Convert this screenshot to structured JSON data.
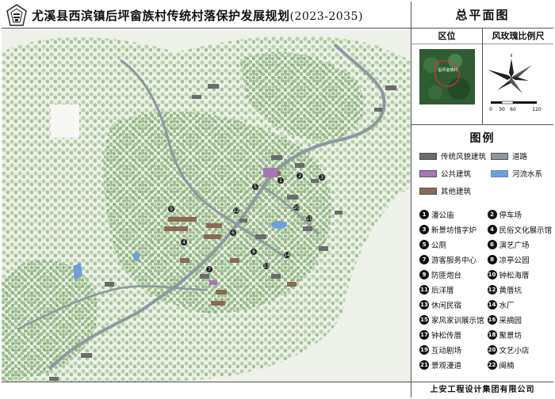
{
  "header": {
    "title": "尤溪县西滨镇后坪畲族村传统村落保护发展规划",
    "years": "(2023-2035)"
  },
  "panel": {
    "title": "总平面图",
    "location_label": "区位",
    "compass_label": "风玫瑰比例尺",
    "scale_ticks": [
      "0",
      "30",
      "60",
      "120"
    ],
    "locator_caption": "后坪畲族村"
  },
  "legend": {
    "title": "图例",
    "symbols": [
      {
        "label": "传统风貌建筑",
        "color": "#6b6b6b"
      },
      {
        "label": "道路",
        "color": "#8d979e"
      },
      {
        "label": "公共建筑",
        "color": "#a873b8"
      },
      {
        "label": "河流水系",
        "color": "#6f9fd8"
      },
      {
        "label": "其他建筑",
        "color": "#8a6a55"
      }
    ],
    "pois": [
      {
        "num": "1",
        "label": "潘公庙"
      },
      {
        "num": "2",
        "label": "停车场"
      },
      {
        "num": "3",
        "label": "新景坊惜字炉"
      },
      {
        "num": "4",
        "label": "民俗文化展示馆"
      },
      {
        "num": "5",
        "label": "公厕"
      },
      {
        "num": "6",
        "label": "演艺广场"
      },
      {
        "num": "7",
        "label": "游客服务中心"
      },
      {
        "num": "8",
        "label": "凉亭公园"
      },
      {
        "num": "9",
        "label": "防匪炮台"
      },
      {
        "num": "10",
        "label": "钟松海厝"
      },
      {
        "num": "11",
        "label": "后洋厝"
      },
      {
        "num": "12",
        "label": "黄厝坑"
      },
      {
        "num": "13",
        "label": "休闲民宿"
      },
      {
        "num": "14",
        "label": "水厂"
      },
      {
        "num": "15",
        "label": "家风家训展示馆"
      },
      {
        "num": "16",
        "label": "采摘园"
      },
      {
        "num": "17",
        "label": "钟松传厝"
      },
      {
        "num": "18",
        "label": "聚景坊"
      },
      {
        "num": "19",
        "label": "互动剧场"
      },
      {
        "num": "20",
        "label": "文艺小店"
      },
      {
        "num": "21",
        "label": "景观漫道"
      },
      {
        "num": "22",
        "label": "闽楠"
      }
    ]
  },
  "footer": {
    "company": "上安工程设计集团有限公司"
  },
  "colors": {
    "vegetation": "#cfe0c4",
    "dense_vegetation": "#a9c79d",
    "road": "#8d979e",
    "traditional_building": "#6b6b6b",
    "public_building": "#a873b8",
    "other_building": "#8a6a55",
    "water": "#6f9fd8"
  }
}
